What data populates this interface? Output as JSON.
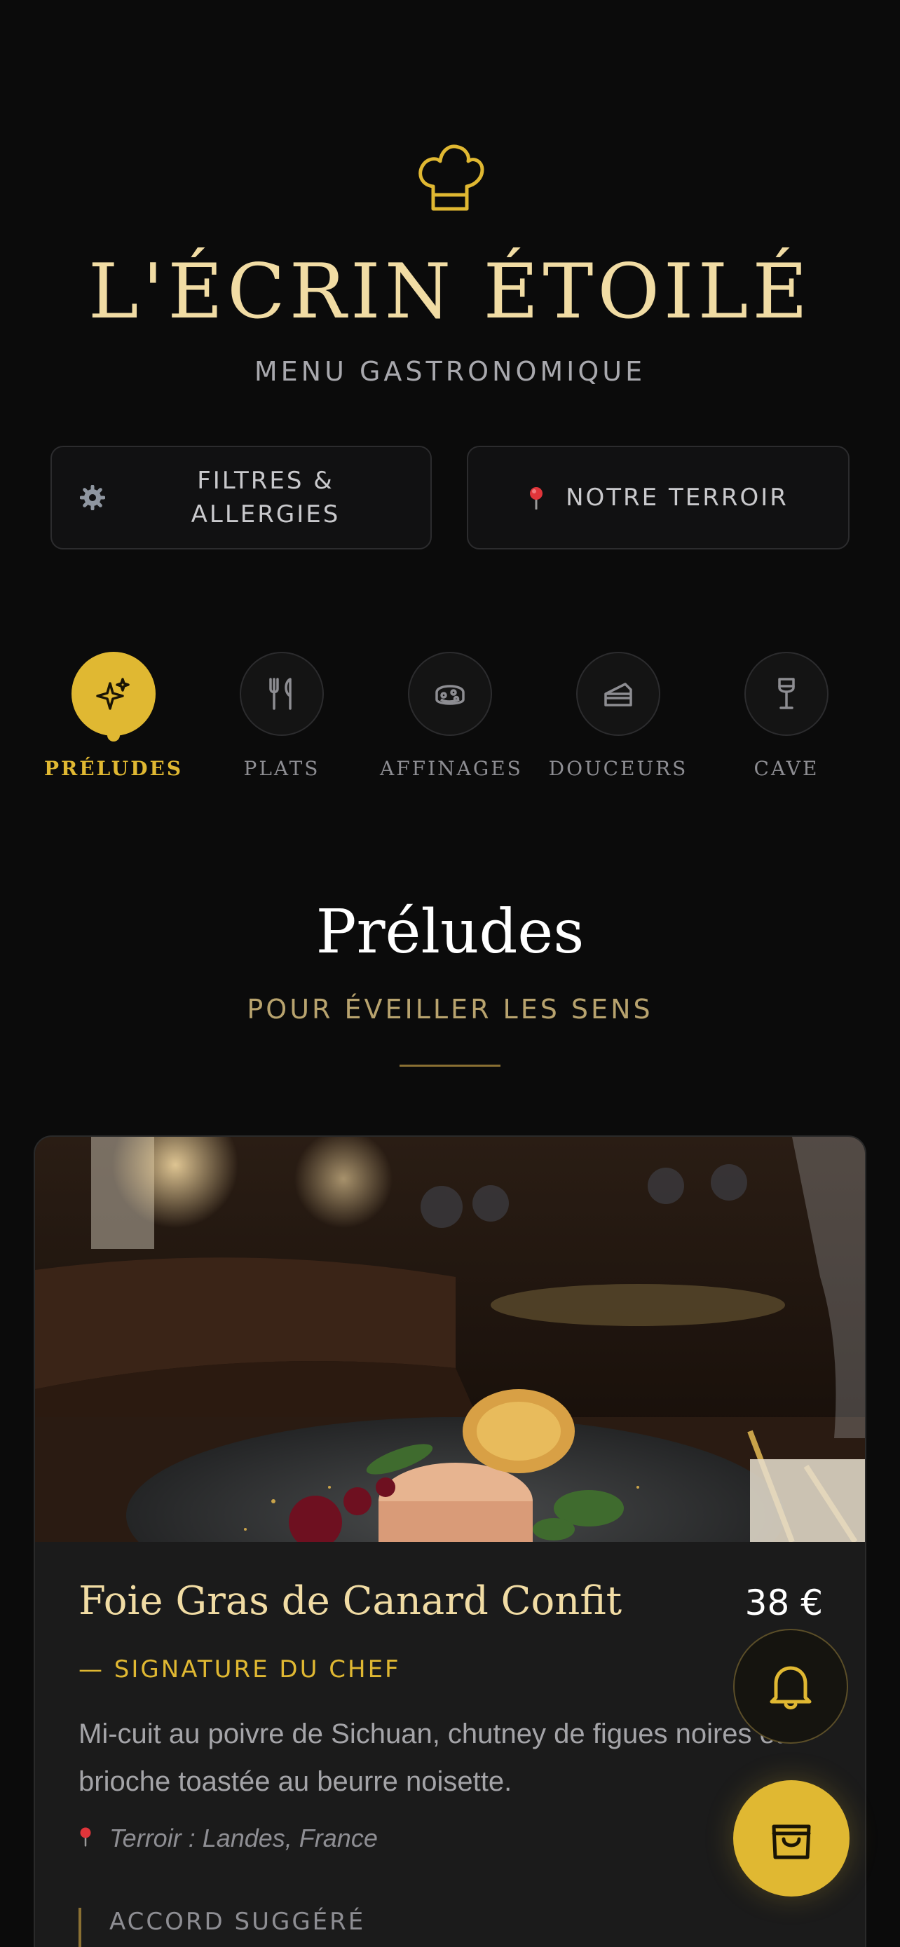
{
  "header": {
    "title": "L'ÉCRIN ÉTOILÉ",
    "subtitle": "MENU GASTRONOMIQUE",
    "icon": "chef-hat-icon"
  },
  "actions": {
    "filters_label": "FILTRES & ALLERGIES",
    "filters_icon": "gear-icon",
    "terroir_label": "NOTRE TERROIR",
    "terroir_icon": "pin-icon"
  },
  "categories": [
    {
      "label": "PRÉLUDES",
      "icon": "sparkles-icon",
      "active": true
    },
    {
      "label": "PLATS",
      "icon": "fork-knife-icon",
      "active": false
    },
    {
      "label": "AFFINAGES",
      "icon": "cheese-icon",
      "active": false
    },
    {
      "label": "DOUCEURS",
      "icon": "cake-icon",
      "active": false
    },
    {
      "label": "CAVE",
      "icon": "wine-glass-icon",
      "active": false
    }
  ],
  "section": {
    "title": "Préludes",
    "subtitle": "POUR ÉVEILLER LES SENS"
  },
  "dish": {
    "name": "Foie Gras de Canard Confit",
    "price": "38 €",
    "tag": "— SIGNATURE DU CHEF",
    "description": "Mi-cuit au poivre de Sichuan, chutney de figues noires et brioche toastée au beurre noisette.",
    "origin": "Terroir : Landes, France",
    "pairing_label": "ACCORD SUGGÉRÉ"
  },
  "fabs": {
    "bell_icon": "bell-icon",
    "cart_icon": "shopping-bag-icon"
  },
  "colors": {
    "accent": "#e0b832",
    "title": "#f1dca4",
    "background": "#0b0b0b"
  }
}
